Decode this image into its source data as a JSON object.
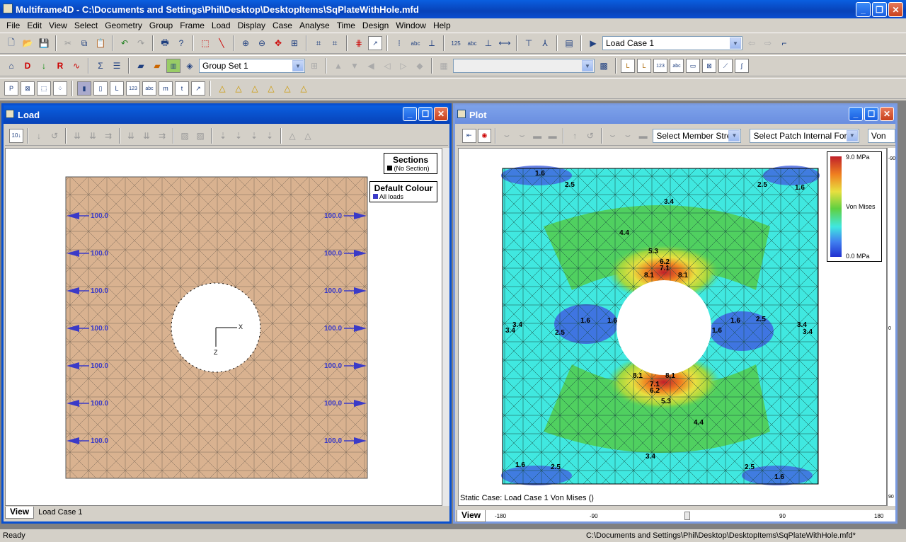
{
  "app": {
    "title": "Multiframe4D - C:\\Documents and Settings\\Phil\\Desktop\\DesktopItems\\SqPlateWithHole.mfd"
  },
  "menu": [
    "File",
    "Edit",
    "View",
    "Select",
    "Geometry",
    "Group",
    "Frame",
    "Load",
    "Display",
    "Case",
    "Analyse",
    "Time",
    "Design",
    "Window",
    "Help"
  ],
  "toolbar": {
    "load_case": "Load Case 1",
    "group_set": "Group Set 1"
  },
  "load_window": {
    "title": "Load",
    "view_tab": "View",
    "view_case": "Load Case 1",
    "sections": {
      "title": "Sections",
      "entry": "(No Section)"
    },
    "colour": {
      "title": "Default Colour",
      "entry": "All loads"
    },
    "load_labels": [
      "100.0",
      "100.0",
      "100.0",
      "100.0",
      "100.0",
      "100.0",
      "100.0",
      "100.0",
      "100.0",
      "100.0",
      "100.0",
      "100.0",
      "100.0",
      "100.0"
    ],
    "axis": {
      "x": "X",
      "z": "Z"
    }
  },
  "plot_window": {
    "title": "Plot",
    "member_stress": "Select Member Stress",
    "patch_force": "Select Patch Internal Force",
    "von": "Von",
    "status": "Static Case: Load Case 1  Von Mises ()",
    "view_tab": "View",
    "legend": {
      "max": "9.0 MPa",
      "label": "Von Mises",
      "min": "0.0 MPa"
    },
    "contour_labels": [
      "1.6",
      "2.5",
      "2.5",
      "1.6",
      "3.4",
      "4.4",
      "5.3",
      "6.2",
      "7.1",
      "8.1",
      "8.1",
      "1.6",
      "1.6",
      "2.5",
      "3.4",
      "3.4",
      "1.6",
      "1.6",
      "2.5",
      "3.4",
      "3.4",
      "8.1",
      "8.1",
      "7.1",
      "6.2",
      "5.3",
      "4.4",
      "3.4",
      "1.6",
      "2.5",
      "2.5",
      "1.6"
    ],
    "h_ruler": [
      "-180",
      "-90",
      "0",
      "90",
      "180"
    ],
    "v_ruler": [
      "-90",
      "0",
      "90"
    ]
  },
  "status": {
    "left": "Ready",
    "path": "C:\\Documents and Settings\\Phil\\Desktop\\DesktopItems\\SqPlateWithHole.mfd*"
  }
}
